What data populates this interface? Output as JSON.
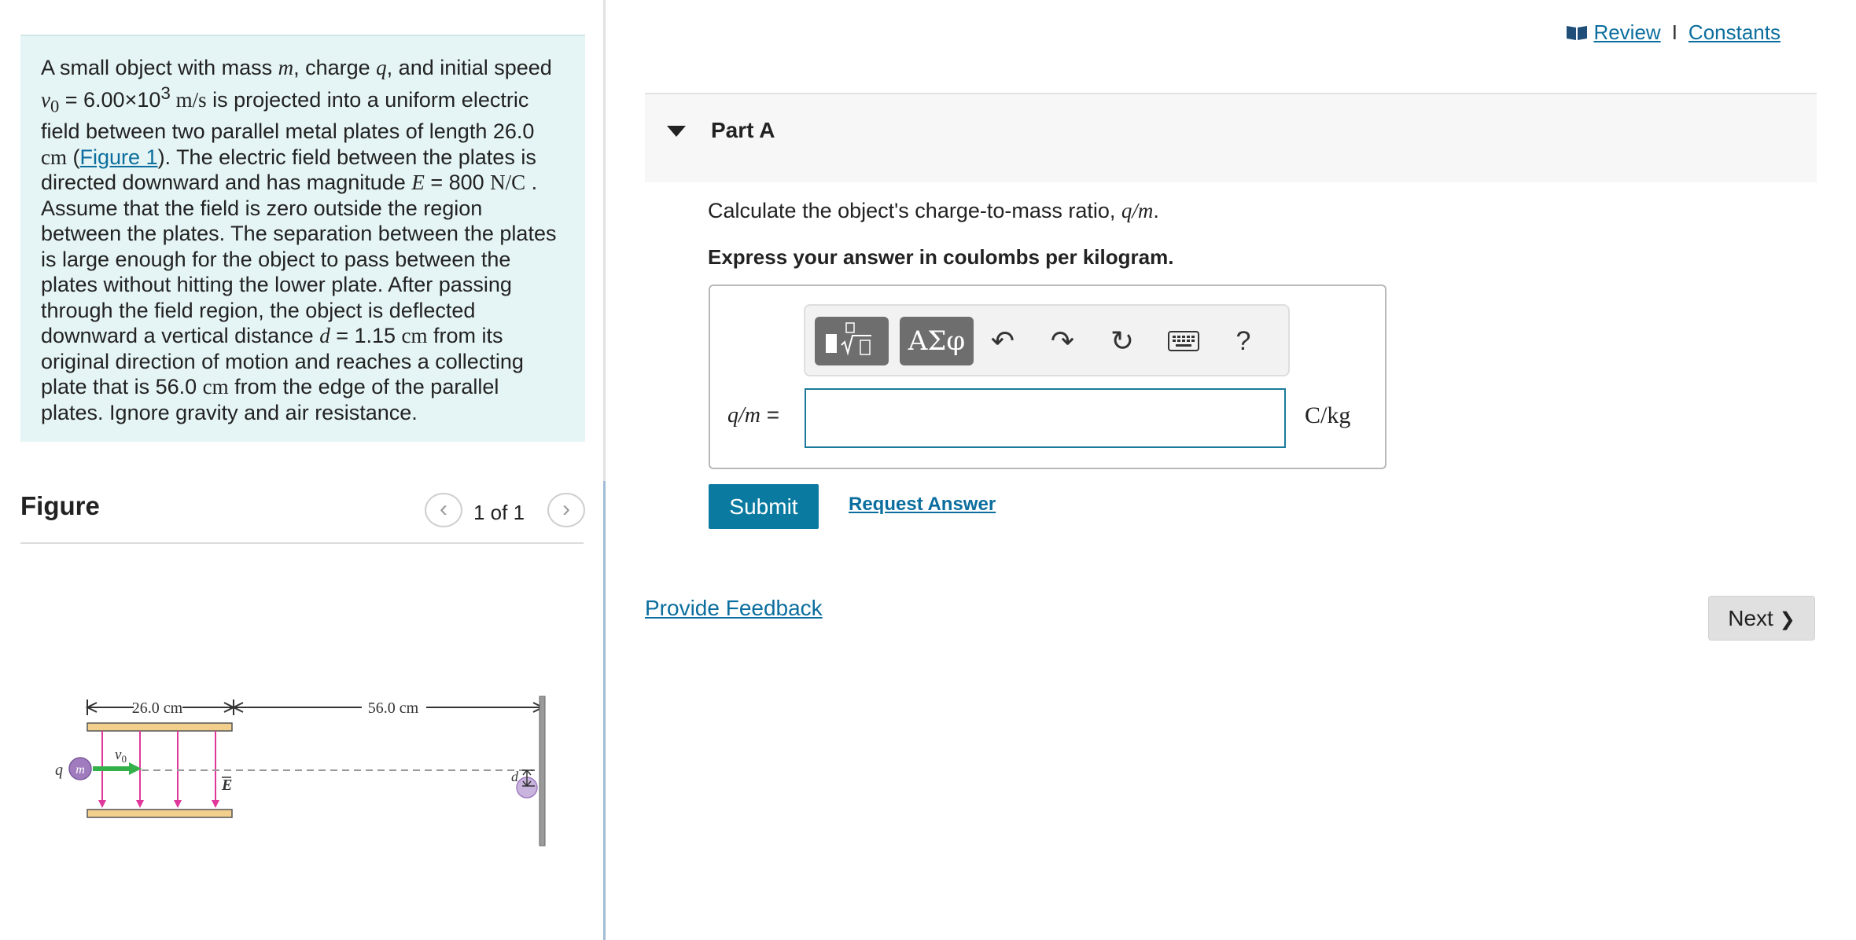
{
  "problem": {
    "t1": "A small object with mass ",
    "m": "m",
    "t2": ", charge ",
    "q": "q",
    "t3": ", and initial speed ",
    "v0": "v",
    "v0_sub": "0",
    "t4": " = 6.00×10",
    "exp": "3",
    "unit_ms": " m/s",
    "t5": " is projected into a uniform electric field between two parallel metal plates of length 26.0 ",
    "unit_cm1": "cm",
    "t6": " (",
    "figure_link": "Figure 1",
    "t7": "). The electric field between the plates is directed downward and has magnitude ",
    "E": "E",
    "t8": " = 800 ",
    "unit_nc": "N/C",
    "t9": " . Assume that the field is zero outside the region between the plates. The separation between the plates is large enough for the object to pass between the plates without hitting the lower plate. After passing through the field region, the object is deflected downward a vertical distance ",
    "d": "d",
    "t10": " = 1.15 ",
    "unit_cm2": "cm",
    "t11": " from its original direction of motion and reaches a collecting plate that is 56.0 ",
    "unit_cm3": "cm",
    "t12": " from the edge of the parallel plates. Ignore gravity and air resistance."
  },
  "figure": {
    "title": "Figure",
    "prev_glyph": "‹",
    "next_glyph": "›",
    "count": "1 of 1",
    "label_plate_length": "26.0 cm",
    "label_distance": "56.0 cm",
    "label_q": "q",
    "label_m": "m",
    "label_v0": "v",
    "label_v0_sub": "0",
    "label_E": "E",
    "label_d": "d"
  },
  "links": {
    "review": "Review",
    "separator": "I",
    "constants": "Constants"
  },
  "part": {
    "title": "Part A",
    "question_text": "Calculate the object's charge-to-mass ratio, ",
    "question_math": "q/m",
    "question_end": ".",
    "instruction": "Express your answer in coulombs per kilogram."
  },
  "answer": {
    "label": "q/m",
    "label_eq": " =",
    "value": "",
    "unit": "C/kg"
  },
  "toolbar": {
    "templates_icon": "templates-icon",
    "greek_label": "ΑΣφ",
    "undo_glyph": "↶",
    "redo_glyph": "↷",
    "reset_glyph": "↻",
    "keyboard_icon": "keyboard-icon",
    "help_glyph": "?"
  },
  "buttons": {
    "submit": "Submit",
    "request_answer": "Request Answer",
    "provide_feedback": "Provide Feedback",
    "next": "Next",
    "next_glyph": "❯"
  },
  "colors": {
    "problem_bg": "#e5f4f4",
    "link": "#0b6e9e",
    "submit_bg": "#0b7aa1",
    "plate": "#f3cf8e",
    "field_line": "#e0389a",
    "velocity_arrow": "#33b04a",
    "object": "#a07cbf"
  }
}
